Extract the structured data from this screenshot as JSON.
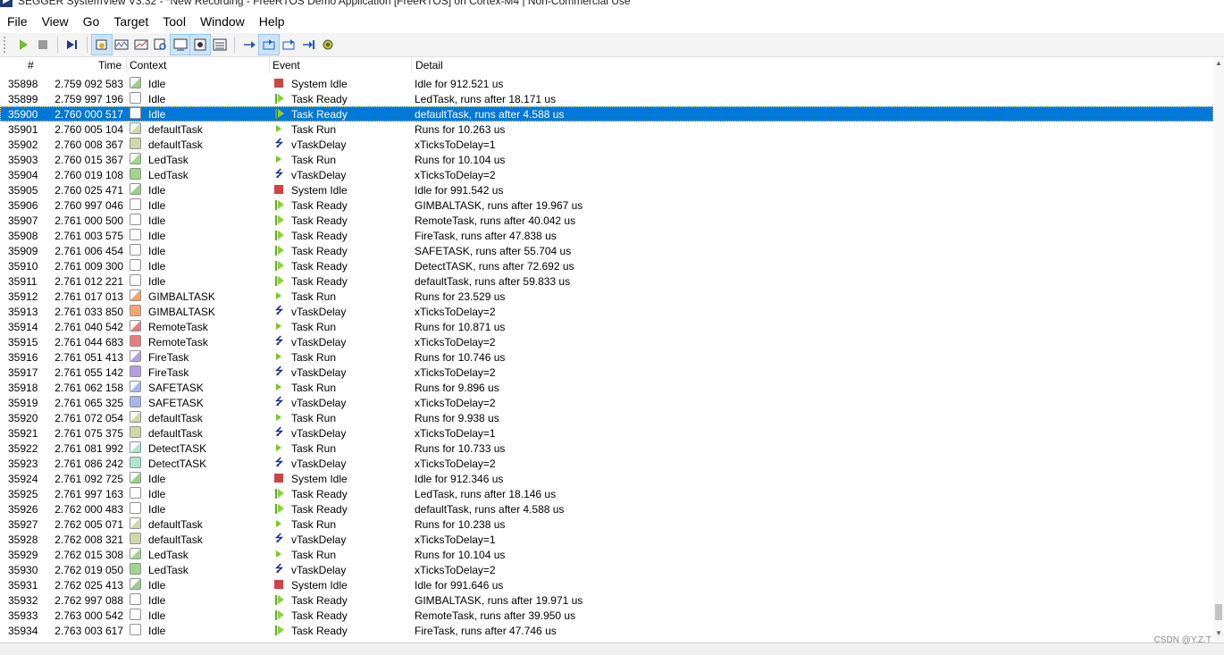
{
  "window": {
    "title": "SEGGER SystemView V3.32 - *New Recording - FreeRTOS Demo Application [FreeRTOS] on Cortex-M4 | Non-Commercial Use"
  },
  "menu": [
    {
      "label": "File",
      "accel": "F",
      "rest": "ile"
    },
    {
      "label": "View",
      "accel": "V",
      "rest": "iew"
    },
    {
      "label": "Go",
      "accel": "G",
      "rest": "o"
    },
    {
      "label": "Target",
      "accel": "T",
      "rest": "arget"
    },
    {
      "label": "Tool",
      "accel": "T",
      "rest": "ool"
    },
    {
      "label": "Window",
      "accel": "W",
      "rest": "indow"
    },
    {
      "label": "Help",
      "accel": "H",
      "rest": "elp"
    }
  ],
  "toolbar": {
    "icons": [
      "play-icon",
      "stop-icon",
      "go-to-end-icon",
      "events-list-icon",
      "timeline-icon",
      "cpu-load-icon",
      "contexts-icon",
      "terminal-icon",
      "runtime-icon",
      "system-info-icon",
      "step-next-icon",
      "step-context-icon",
      "step-back-icon",
      "step-forward-icon",
      "settings-icon"
    ]
  },
  "columns": {
    "num": "#",
    "time": "Time",
    "context": "Context",
    "event": "Event",
    "detail": "Detail"
  },
  "context_colors": {
    "Idle": "#ffffff",
    "defaultTask": "#cfd9a8",
    "LedTask": "#9ed68a",
    "GIMBALTASK": "#f5a46e",
    "RemoteTask": "#ec7b7b",
    "FireTask": "#b79be8",
    "SAFETASK": "#a7b7ec",
    "DetectTASK": "#a9e8cc"
  },
  "events": [
    {
      "num": "35898",
      "time": "2.759 092 583",
      "context": "Idle",
      "icon": "idle",
      "event": "System Idle",
      "detail": "Idle for 912.521 us"
    },
    {
      "num": "35899",
      "time": "2.759 997 196",
      "context": "Idle",
      "icon": "ready",
      "event": "Task Ready",
      "detail": "LedTask, runs after 18.171 us"
    },
    {
      "num": "35900",
      "time": "2.760 000 517",
      "context": "Idle",
      "icon": "ready",
      "event": "Task Ready",
      "detail": "defaultTask, runs after 4.588 us",
      "selected": true
    },
    {
      "num": "35901",
      "time": "2.760 005 104",
      "context": "defaultTask",
      "icon": "run",
      "event": "Task Run",
      "detail": "Runs for 10.263 us"
    },
    {
      "num": "35902",
      "time": "2.760 008 367",
      "context": "defaultTask",
      "icon": "delay",
      "event": "vTaskDelay",
      "detail": "xTicksToDelay=1"
    },
    {
      "num": "35903",
      "time": "2.760 015 367",
      "context": "LedTask",
      "icon": "run",
      "event": "Task Run",
      "detail": "Runs for 10.104 us"
    },
    {
      "num": "35904",
      "time": "2.760 019 108",
      "context": "LedTask",
      "icon": "delay",
      "event": "vTaskDelay",
      "detail": "xTicksToDelay=2"
    },
    {
      "num": "35905",
      "time": "2.760 025 471",
      "context": "Idle",
      "icon": "idle",
      "event": "System Idle",
      "detail": "Idle for 991.542 us"
    },
    {
      "num": "35906",
      "time": "2.760 997 046",
      "context": "Idle",
      "icon": "ready",
      "event": "Task Ready",
      "detail": "GIMBALTASK, runs after 19.967 us"
    },
    {
      "num": "35907",
      "time": "2.761 000 500",
      "context": "Idle",
      "icon": "ready",
      "event": "Task Ready",
      "detail": "RemoteTask, runs after 40.042 us"
    },
    {
      "num": "35908",
      "time": "2.761 003 575",
      "context": "Idle",
      "icon": "ready",
      "event": "Task Ready",
      "detail": "FireTask, runs after 47.838 us"
    },
    {
      "num": "35909",
      "time": "2.761 006 454",
      "context": "Idle",
      "icon": "ready",
      "event": "Task Ready",
      "detail": "SAFETASK, runs after 55.704 us"
    },
    {
      "num": "35910",
      "time": "2.761 009 300",
      "context": "Idle",
      "icon": "ready",
      "event": "Task Ready",
      "detail": "DetectTASK, runs after 72.692 us"
    },
    {
      "num": "35911",
      "time": "2.761 012 221",
      "context": "Idle",
      "icon": "ready",
      "event": "Task Ready",
      "detail": "defaultTask, runs after 59.833 us"
    },
    {
      "num": "35912",
      "time": "2.761 017 013",
      "context": "GIMBALTASK",
      "icon": "run",
      "event": "Task Run",
      "detail": "Runs for 23.529 us"
    },
    {
      "num": "35913",
      "time": "2.761 033 850",
      "context": "GIMBALTASK",
      "icon": "delay",
      "event": "vTaskDelay",
      "detail": "xTicksToDelay=2"
    },
    {
      "num": "35914",
      "time": "2.761 040 542",
      "context": "RemoteTask",
      "icon": "run",
      "event": "Task Run",
      "detail": "Runs for 10.871 us"
    },
    {
      "num": "35915",
      "time": "2.761 044 683",
      "context": "RemoteTask",
      "icon": "delay",
      "event": "vTaskDelay",
      "detail": "xTicksToDelay=2"
    },
    {
      "num": "35916",
      "time": "2.761 051 413",
      "context": "FireTask",
      "icon": "run",
      "event": "Task Run",
      "detail": "Runs for 10.746 us"
    },
    {
      "num": "35917",
      "time": "2.761 055 142",
      "context": "FireTask",
      "icon": "delay",
      "event": "vTaskDelay",
      "detail": "xTicksToDelay=2"
    },
    {
      "num": "35918",
      "time": "2.761 062 158",
      "context": "SAFETASK",
      "icon": "run",
      "event": "Task Run",
      "detail": "Runs for 9.896 us"
    },
    {
      "num": "35919",
      "time": "2.761 065 325",
      "context": "SAFETASK",
      "icon": "delay",
      "event": "vTaskDelay",
      "detail": "xTicksToDelay=2"
    },
    {
      "num": "35920",
      "time": "2.761 072 054",
      "context": "defaultTask",
      "icon": "run",
      "event": "Task Run",
      "detail": "Runs for 9.938 us"
    },
    {
      "num": "35921",
      "time": "2.761 075 375",
      "context": "defaultTask",
      "icon": "delay",
      "event": "vTaskDelay",
      "detail": "xTicksToDelay=1"
    },
    {
      "num": "35922",
      "time": "2.761 081 992",
      "context": "DetectTASK",
      "icon": "run",
      "event": "Task Run",
      "detail": "Runs for 10.733 us"
    },
    {
      "num": "35923",
      "time": "2.761 086 242",
      "context": "DetectTASK",
      "icon": "delay",
      "event": "vTaskDelay",
      "detail": "xTicksToDelay=2"
    },
    {
      "num": "35924",
      "time": "2.761 092 725",
      "context": "Idle",
      "icon": "idle",
      "event": "System Idle",
      "detail": "Idle for 912.346 us"
    },
    {
      "num": "35925",
      "time": "2.761 997 163",
      "context": "Idle",
      "icon": "ready",
      "event": "Task Ready",
      "detail": "LedTask, runs after 18.146 us"
    },
    {
      "num": "35926",
      "time": "2.762 000 483",
      "context": "Idle",
      "icon": "ready",
      "event": "Task Ready",
      "detail": "defaultTask, runs after 4.588 us"
    },
    {
      "num": "35927",
      "time": "2.762 005 071",
      "context": "defaultTask",
      "icon": "run",
      "event": "Task Run",
      "detail": "Runs for 10.238 us"
    },
    {
      "num": "35928",
      "time": "2.762 008 321",
      "context": "defaultTask",
      "icon": "delay",
      "event": "vTaskDelay",
      "detail": "xTicksToDelay=1"
    },
    {
      "num": "35929",
      "time": "2.762 015 308",
      "context": "LedTask",
      "icon": "run",
      "event": "Task Run",
      "detail": "Runs for 10.104 us"
    },
    {
      "num": "35930",
      "time": "2.762 019 050",
      "context": "LedTask",
      "icon": "delay",
      "event": "vTaskDelay",
      "detail": "xTicksToDelay=2"
    },
    {
      "num": "35931",
      "time": "2.762 025 413",
      "context": "Idle",
      "icon": "idle",
      "event": "System Idle",
      "detail": "Idle for 991.646 us"
    },
    {
      "num": "35932",
      "time": "2.762 997 088",
      "context": "Idle",
      "icon": "ready",
      "event": "Task Ready",
      "detail": "GIMBALTASK, runs after 19.971 us"
    },
    {
      "num": "35933",
      "time": "2.763 000 542",
      "context": "Idle",
      "icon": "ready",
      "event": "Task Ready",
      "detail": "RemoteTask, runs after 39.950 us"
    },
    {
      "num": "35934",
      "time": "2.763 003 617",
      "context": "Idle",
      "icon": "ready",
      "event": "Task Ready",
      "detail": "FireTask, runs after 47.746 us"
    }
  ],
  "watermark": "CSDN @Y.Z.T"
}
